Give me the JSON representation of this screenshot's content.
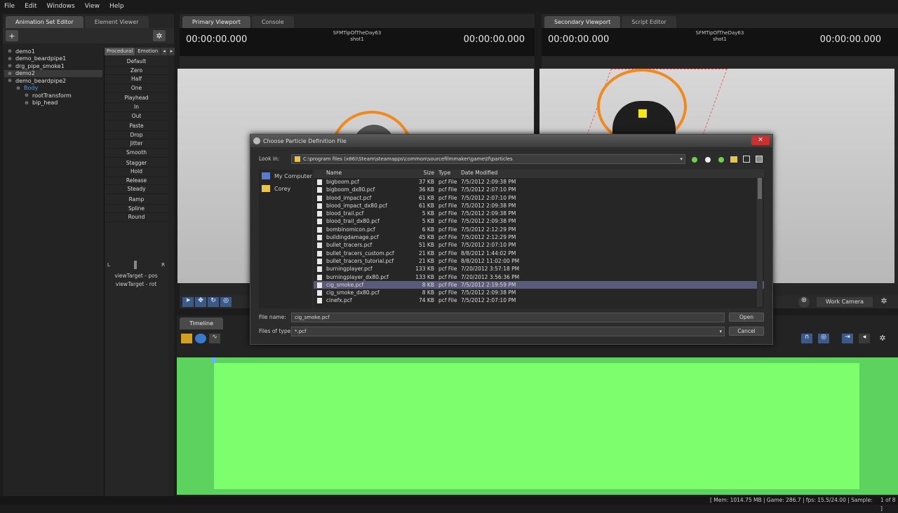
{
  "menu": [
    "File",
    "Edit",
    "Windows",
    "View",
    "Help"
  ],
  "left_panel": {
    "tabs": [
      "Animation Set Editor",
      "Element Viewer"
    ],
    "tree": [
      {
        "label": "demo1",
        "indent": 0
      },
      {
        "label": "demo_beardpipe1",
        "indent": 0
      },
      {
        "label": "drg_pipe_smoke1",
        "indent": 0
      },
      {
        "label": "demo2",
        "indent": 0,
        "selected": true
      },
      {
        "label": "demo_beardpipe2",
        "indent": 0
      },
      {
        "label": "Body",
        "indent": 1,
        "blue": true
      },
      {
        "label": "rootTransform",
        "indent": 2
      },
      {
        "label": "bip_head",
        "indent": 2
      }
    ],
    "proc_tabs": [
      "Procedural",
      "Emotion"
    ],
    "proc_items": [
      "Default",
      "Zero",
      "Half",
      "One",
      "Playhead",
      "In",
      "Out",
      "Paste",
      "Drop",
      "Jitter",
      "Smooth",
      "Stagger",
      "Hold",
      "Release",
      "Steady",
      "Ramp",
      "Spline",
      "Round"
    ],
    "slider_left": "L",
    "slider_right": "R",
    "view_targets": [
      "viewTarget - pos",
      "viewTarget - rot"
    ]
  },
  "primary_viewport": {
    "tabs": [
      "Primary Viewport",
      "Console"
    ],
    "time_left": "00:00:00.000",
    "time_right": "00:00:00.000",
    "session": "SFMTipOfTheDay63",
    "shot": "shot1"
  },
  "secondary_viewport": {
    "tabs": [
      "Secondary Viewport",
      "Script Editor"
    ],
    "time_left": "00:00:00.000",
    "time_right": "00:00:00.000",
    "session": "SFMTipOfTheDay63",
    "shot": "shot1",
    "camera_button": "Work Camera"
  },
  "timeline": {
    "tab": "Timeline"
  },
  "status_bar": {
    "text": "[ Mem: 1014.75 MB | Game:     286.7 | fps:  15.5/24.00 | Sample:",
    "page": "1 of 8 ]"
  },
  "dialog": {
    "title": "Choose Particle Definition File",
    "look_in_label": "Look in:",
    "look_in_path": "C:\\program files (x86)\\Steam\\steamapps\\common\\sourcefilmmaker\\game\\tf\\particles",
    "places": [
      "My Computer",
      "Corey"
    ],
    "columns": [
      "Name",
      "Size",
      "Type",
      "Date Modified"
    ],
    "files": [
      {
        "name": "bigboom.pcf",
        "size": "37 KB",
        "type": "pcf File",
        "date": "7/5/2012 2:09:38 PM"
      },
      {
        "name": "bigboom_dx80.pcf",
        "size": "36 KB",
        "type": "pcf File",
        "date": "7/5/2012 2:07:10 PM"
      },
      {
        "name": "blood_impact.pcf",
        "size": "61 KB",
        "type": "pcf File",
        "date": "7/5/2012 2:07:10 PM"
      },
      {
        "name": "blood_impact_dx80.pcf",
        "size": "61 KB",
        "type": "pcf File",
        "date": "7/5/2012 2:09:38 PM"
      },
      {
        "name": "blood_trail.pcf",
        "size": "5 KB",
        "type": "pcf File",
        "date": "7/5/2012 2:09:38 PM"
      },
      {
        "name": "blood_trail_dx80.pcf",
        "size": "5 KB",
        "type": "pcf File",
        "date": "7/5/2012 2:09:38 PM"
      },
      {
        "name": "bombinomicon.pcf",
        "size": "6 KB",
        "type": "pcf File",
        "date": "7/5/2012 2:12:29 PM"
      },
      {
        "name": "buildingdamage.pcf",
        "size": "45 KB",
        "type": "pcf File",
        "date": "7/5/2012 2:12:29 PM"
      },
      {
        "name": "bullet_tracers.pcf",
        "size": "51 KB",
        "type": "pcf File",
        "date": "7/5/2012 2:07:10 PM"
      },
      {
        "name": "bullet_tracers_custom.pcf",
        "size": "21 KB",
        "type": "pcf File",
        "date": "8/8/2012 1:44:02 PM"
      },
      {
        "name": "bullet_tracers_tutorial.pcf",
        "size": "21 KB",
        "type": "pcf File",
        "date": "8/8/2012 11:02:00 PM"
      },
      {
        "name": "burningplayer.pcf",
        "size": "133 KB",
        "type": "pcf File",
        "date": "7/20/2012 3:57:18 PM"
      },
      {
        "name": "burningplayer_dx80.pcf",
        "size": "133 KB",
        "type": "pcf File",
        "date": "7/20/2012 3:56:36 PM"
      },
      {
        "name": "cig_smoke.pcf",
        "size": "8 KB",
        "type": "pcf File",
        "date": "7/5/2012 2:19:59 PM",
        "selected": true
      },
      {
        "name": "cig_smoke_dx80.pcf",
        "size": "8 KB",
        "type": "pcf File",
        "date": "7/5/2012 2:09:38 PM"
      },
      {
        "name": "cinefx.pcf",
        "size": "74 KB",
        "type": "pcf File",
        "date": "7/5/2012 2:07:10 PM"
      }
    ],
    "file_name_label": "File name:",
    "file_name_value": "cig_smoke.pcf",
    "files_of_type_label": "Files of type:",
    "files_of_type_value": "*.pcf",
    "open_button": "Open",
    "cancel_button": "Cancel"
  },
  "colors": {
    "timeline_green": "#7dff6d",
    "orange_ring": "#f08a1c",
    "selection": "#5a5a7a"
  }
}
